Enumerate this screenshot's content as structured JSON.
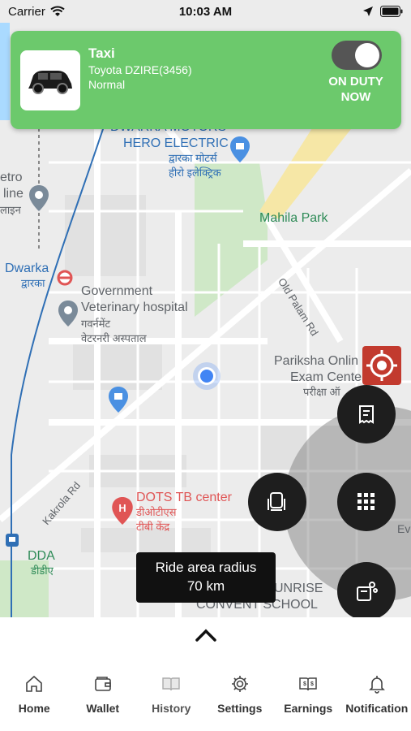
{
  "status_bar": {
    "carrier": "Carrier",
    "time": "10:03 AM"
  },
  "vehicle": {
    "type": "Taxi",
    "model": "Toyota DZIRE(3456)",
    "status": "Normal"
  },
  "duty": {
    "label_line1": "ON DUTY",
    "label_line2": "NOW",
    "on": true
  },
  "ride_area": {
    "label": "Ride area radius",
    "value": "70 km"
  },
  "map_labels": {
    "dwarka_mor": "DWARKA MOTORS",
    "hero": "HERO ELECTRIC",
    "hero_hi1": "द्वारका मोटर्स",
    "hero_hi2": "हीरो इलेक्ट्रिक",
    "metro_1": "etro",
    "metro_2": "line",
    "metro_3": "लाइन",
    "mahila": "Mahila Park",
    "old_palam": "Old Palam Rd",
    "dwarka": "Dwarka",
    "dwarka_hi": "द्वारका",
    "govt1": "Government",
    "govt2": "Veterinary hospital",
    "govt_hi1": "गवर्नमेंट",
    "govt_hi2": "वेटरनरी अस्पताल",
    "pariksha1": "Pariksha Onlin",
    "pariksha2": "Exam Cente",
    "pariksha_hi": "परीक्षा ऑ",
    "kakrola": "Kakrola Rd",
    "dots": "DOTS TB center",
    "dots_hi1": "डीओटीएस",
    "dots_hi2": "टीबी केंद्र",
    "dda": "DDA",
    "dda_hi": "डीडीए",
    "sunrise1": "UNRISE",
    "sunrise2": "CONVENT SCHOOL",
    "eve": "Eve"
  },
  "tabs": [
    {
      "label": "Home",
      "icon": "home-icon"
    },
    {
      "label": "Wallet",
      "icon": "wallet-icon"
    },
    {
      "label": "History",
      "icon": "book-icon"
    },
    {
      "label": "Settings",
      "icon": "gear-icon"
    },
    {
      "label": "Earnings",
      "icon": "earnings-icon"
    },
    {
      "label": "Notification",
      "icon": "bell-icon"
    }
  ],
  "colors": {
    "card": "#6cc96c",
    "target": "#c23a2e",
    "fab": "#1e1e1e",
    "user_dot": "#4285f4"
  }
}
